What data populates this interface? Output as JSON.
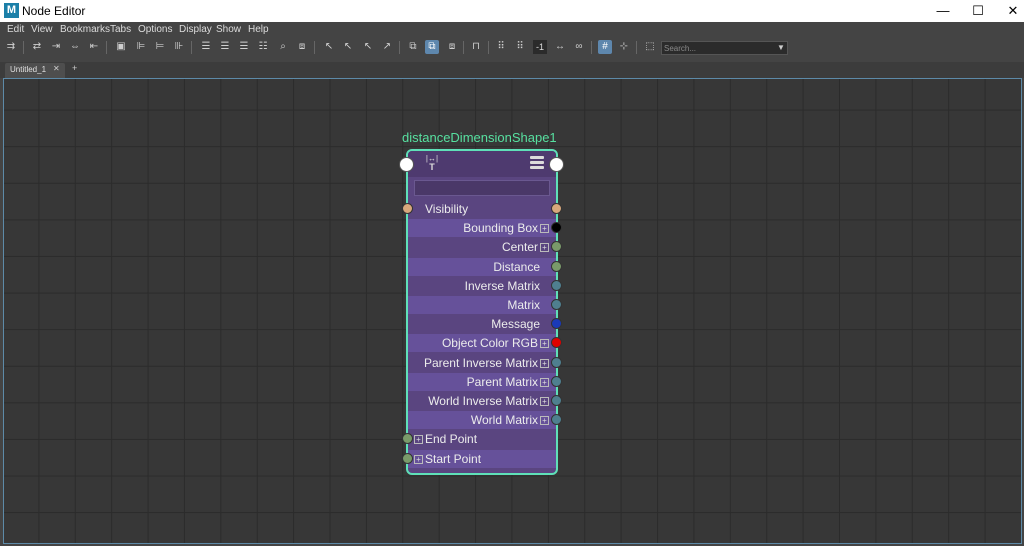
{
  "window": {
    "app_icon": "M",
    "title": "Node Editor",
    "minimize": "—",
    "maximize": "☐",
    "close": "✕"
  },
  "menubar": [
    "Edit",
    "View",
    "Bookmarks",
    "Tabs",
    "Options",
    "Display",
    "Show",
    "Help"
  ],
  "toolbar": {
    "search_placeholder": "Search...",
    "field_value": "-1",
    "search_dropdown": "▼"
  },
  "tabs": {
    "active": "Untitled_1",
    "close": "✕",
    "add": "+"
  },
  "node": {
    "name": "distanceDimensionShape1",
    "type_icon_label": "T",
    "attributes": [
      {
        "label": "Visibility",
        "align": "left",
        "expandable": false,
        "in_port": "#d8a87c",
        "out_port": "#d8a87c"
      },
      {
        "label": "Bounding Box",
        "align": "right",
        "expandable": true,
        "out_port": "#000000"
      },
      {
        "label": "Center",
        "align": "right",
        "expandable": true,
        "out_port": "#7a9a6a"
      },
      {
        "label": "Distance",
        "align": "right",
        "expandable": false,
        "out_port": "#7a9a6a"
      },
      {
        "label": "Inverse Matrix",
        "align": "right",
        "expandable": false,
        "out_port": "#4f7f8f"
      },
      {
        "label": "Matrix",
        "align": "right",
        "expandable": false,
        "out_port": "#4f7f8f"
      },
      {
        "label": "Message",
        "align": "right",
        "expandable": false,
        "out_port": "#1a3ab8"
      },
      {
        "label": "Object Color RGB",
        "align": "right",
        "expandable": true,
        "out_port": "#e00000"
      },
      {
        "label": "Parent Inverse Matrix",
        "align": "right",
        "expandable": true,
        "out_port": "#4f7f8f"
      },
      {
        "label": "Parent Matrix",
        "align": "right",
        "expandable": true,
        "out_port": "#4f7f8f"
      },
      {
        "label": "World Inverse Matrix",
        "align": "right",
        "expandable": true,
        "out_port": "#4f7f8f"
      },
      {
        "label": "World Matrix",
        "align": "right",
        "expandable": true,
        "out_port": "#4f7f8f"
      },
      {
        "label": "End Point",
        "align": "left",
        "expandable": true,
        "in_port": "#7a9a6a"
      },
      {
        "label": "Start Point",
        "align": "left",
        "expandable": true,
        "in_port": "#7a9a6a"
      }
    ]
  },
  "colors": {
    "accent_outline": "#5fe0b8",
    "node_title": "#57e0a0",
    "node_body": "#5a4580"
  }
}
